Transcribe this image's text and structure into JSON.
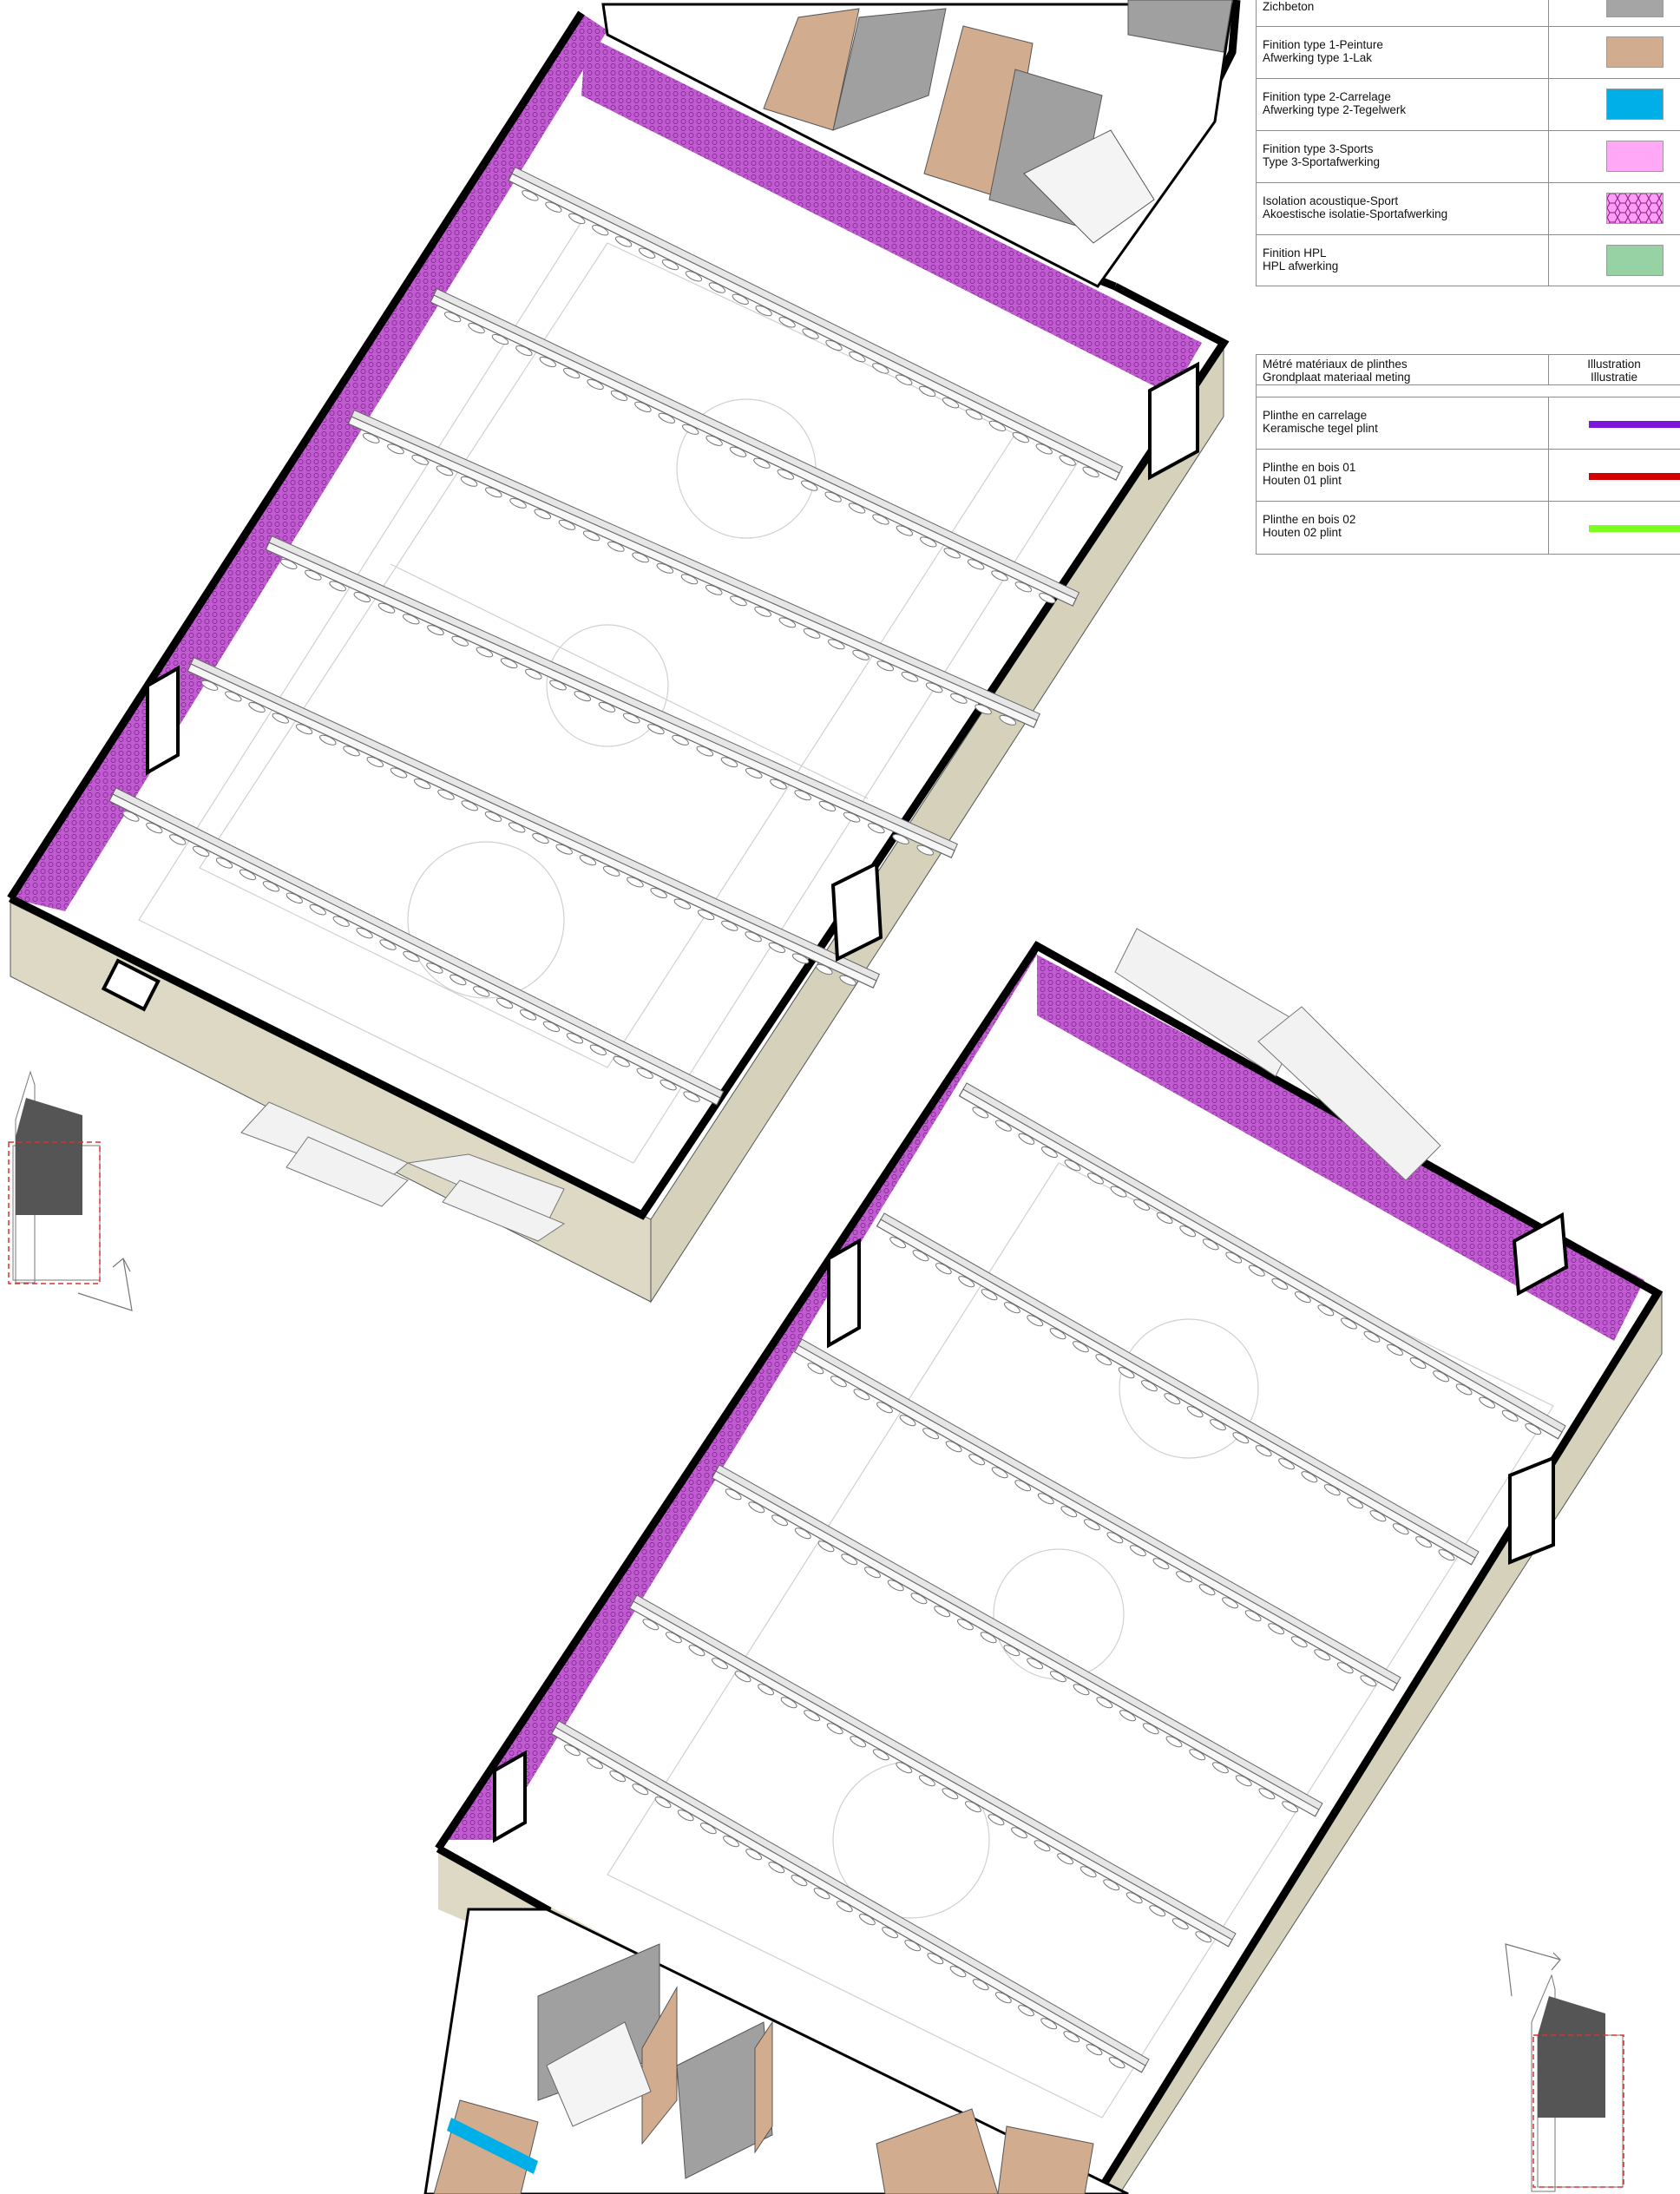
{
  "finishes_legend": {
    "rows": [
      {
        "fr": "Zichbeton",
        "nl": "",
        "color": "#a5a5a5"
      },
      {
        "fr": "Finition type 1-Peinture",
        "nl": "Afwerking type 1-Lak",
        "color": "#d1ac8e"
      },
      {
        "fr": "Finition type 2-Carrelage",
        "nl": "Afwerking type 2-Tegelwerk",
        "color": "#00aee8"
      },
      {
        "fr": "Finition type 3-Sports",
        "nl": "Type 3-Sportafwerking",
        "color": "#ffa8f6"
      },
      {
        "fr": "Isolation acoustique-Sport",
        "nl": "Akoestische isolatie-Sportafwerking",
        "color": "#e466e0",
        "pattern": "hexagon"
      },
      {
        "fr": "Finition HPL",
        "nl": "HPL afwerking",
        "color": "#96d2a3"
      }
    ]
  },
  "plinth_legend": {
    "header_fr": "Métré matériaux de plinthes",
    "header_nl": "Grondplaat materiaal meting",
    "illustration_fr": "Illustration",
    "illustration_nl": "Illustratie",
    "rows": [
      {
        "fr": "Plinthe en carrelage",
        "nl": "Keramische tegel plint",
        "color": "#7c16dc"
      },
      {
        "fr": "Plinthe en bois 01",
        "nl": "Houten 01 plint",
        "color": "#d40000"
      },
      {
        "fr": "Plinthe en bois 02",
        "nl": "Houten 02 plint",
        "color": "#7cff1e"
      }
    ]
  },
  "colors": {
    "wall_thick": "#000000",
    "wall_face": "#ddd9c5",
    "acoustic": "#b452c6",
    "paint": "#d1ac8e",
    "concrete": "#a0a0a0",
    "tile": "#00aee8",
    "keyplan_block": "#555555",
    "keyplan_outline": "#e03030"
  }
}
